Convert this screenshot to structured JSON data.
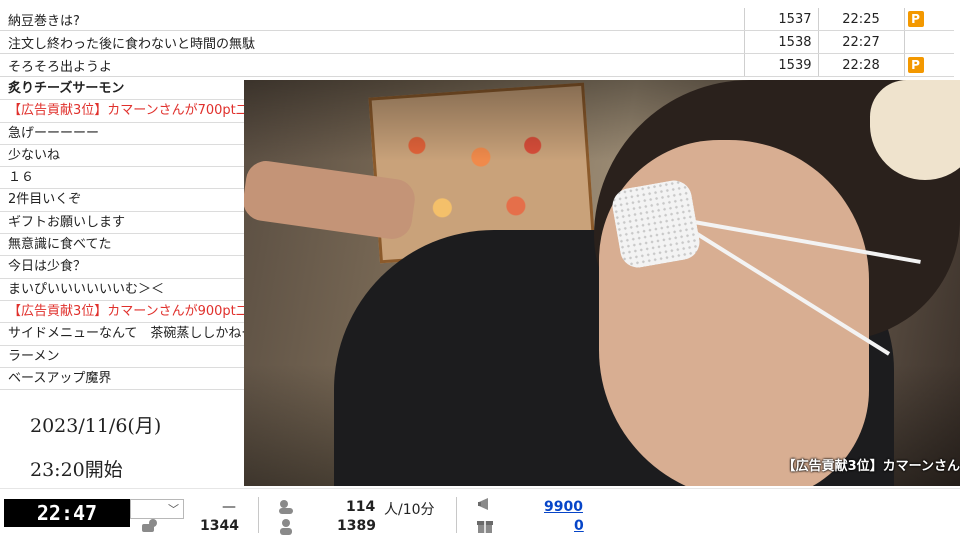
{
  "top_comments": [
    {
      "text": "納豆巻きは?",
      "no": "1537",
      "time": "22:25",
      "badge": "P"
    },
    {
      "text": "注文し終わった後に食わないと時間の無駄",
      "no": "1538",
      "time": "22:27",
      "badge": ""
    },
    {
      "text": "そろそろ出ようよ",
      "no": "1539",
      "time": "22:28",
      "badge": "P"
    }
  ],
  "side_comments": [
    {
      "text": "炙りチーズサーモン"
    },
    {
      "text": "【広告貢献3位】カマーンさんが700pt二"
    },
    {
      "text": "急げーーーーー"
    },
    {
      "text": "少ないね"
    },
    {
      "text": "１６"
    },
    {
      "text": "2件目いくぞ"
    },
    {
      "text": "ギフトお願いします"
    },
    {
      "text": "無意識に食べてた"
    },
    {
      "text": "今日は少食？"
    },
    {
      "text": "まいぴいいいいいいむ＞＜"
    },
    {
      "text": "【広告貢献3位】カマーンさんが900pt二"
    },
    {
      "text": "サイドメニューなんて　茶碗蒸ししかねー"
    },
    {
      "text": "ラーメン"
    },
    {
      "text": "ベースアップ魔界"
    }
  ],
  "stream_date": "2023/11/6(月)",
  "stream_start": "23:20開始",
  "ticker_text": "【広告貢献3位】カマーンさん",
  "status": {
    "elapsed": "22:47",
    "dash": "—",
    "stat1": "1344",
    "viewers": "114",
    "viewers_unit": "人/10分",
    "stat2": "1389",
    "ad_points": "9900",
    "gift_points": "0"
  },
  "colors": {
    "red_comment": "#e0302c",
    "badge": "#f39800",
    "link": "#0645c8"
  }
}
